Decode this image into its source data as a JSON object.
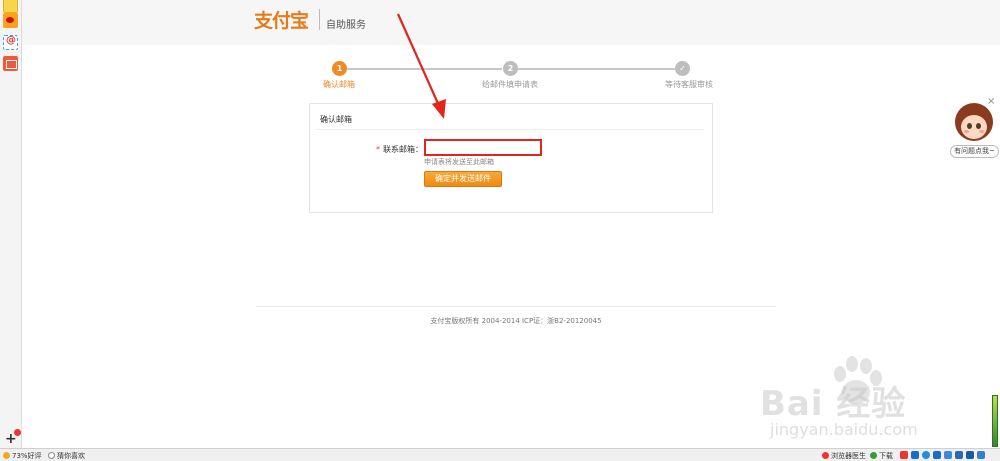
{
  "header": {
    "logo_text": "支付宝",
    "subtitle": "自助服务"
  },
  "steps": [
    {
      "number": "1",
      "label": "确认邮箱",
      "state": "active"
    },
    {
      "number": "2",
      "label": "给邮件填申请表",
      "state": "pending"
    },
    {
      "number": "✓",
      "label": "等待客服审核",
      "state": "pending"
    }
  ],
  "form": {
    "panel_title": "确认邮箱",
    "required_mark": "*",
    "email_label": "联系邮箱：",
    "email_value": "",
    "hint": "申请表将发送至此邮箱",
    "submit_label": "确定并发送邮件"
  },
  "footer": {
    "copyright": "支付宝版权所有 2004-2014 ICP证：浙B2-20120045"
  },
  "help_widget": {
    "close_label": "×",
    "button_label": "有问题点我~"
  },
  "watermark": {
    "brand": "Bai  经验",
    "url": "jingyan.baidu.com"
  },
  "status_bar": {
    "rating": "73%好评",
    "guess_like": "猜你喜欢",
    "doctor": "浏览器医生",
    "download": "下载"
  },
  "colors": {
    "accent": "#f08a24",
    "error_border": "#e0261d",
    "annotation_arrow": "#e0261d"
  }
}
